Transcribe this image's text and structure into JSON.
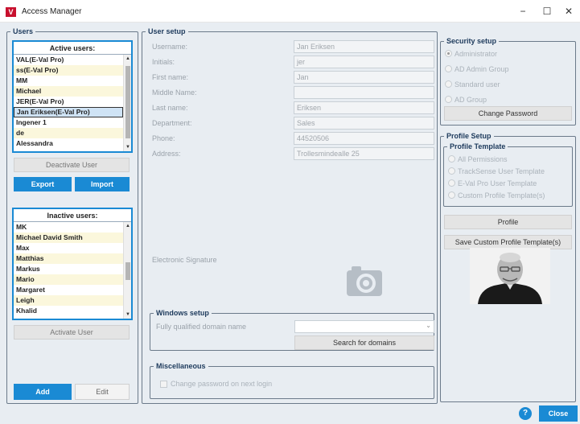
{
  "window": {
    "app_icon_letter": "V",
    "title": "Access Manager",
    "minimize": "−",
    "maximize": "☐",
    "close": "✕"
  },
  "users": {
    "legend": "Users",
    "active_header": "Active users:",
    "active_items": [
      "VAL(E-Val Pro)",
      "ss(E-Val Pro)",
      "MM",
      "Michael",
      "JER(E-Val Pro)",
      "Jan Eriksen(E-Val Pro)",
      "Ingener 1",
      "de",
      "Alessandra"
    ],
    "active_selected_index": 5,
    "deactivate_label": "Deactivate User",
    "export_label": "Export",
    "import_label": "Import",
    "inactive_header": "Inactive users:",
    "inactive_items": [
      "MK",
      "Michael David Smith",
      "Max",
      "Matthias",
      "Markus",
      "Mario",
      "Margaret",
      "Leigh",
      "Khalid"
    ],
    "activate_label": "Activate User",
    "add_label": "Add",
    "edit_label": "Edit"
  },
  "user_setup": {
    "legend": "User setup",
    "fields": [
      {
        "label": "Username:",
        "value": "Jan Eriksen"
      },
      {
        "label": "Initials:",
        "value": "jer"
      },
      {
        "label": "First name:",
        "value": "Jan"
      },
      {
        "label": "Middle Name:",
        "value": ""
      },
      {
        "label": "Last name:",
        "value": "Eriksen"
      },
      {
        "label": "Department:",
        "value": "Sales"
      },
      {
        "label": "Phone:",
        "value": "44520506"
      },
      {
        "label": "Address:",
        "value": "Trollesmindealle 25"
      }
    ],
    "signature_label": "Electronic Signature",
    "camera_icon": "camera-icon",
    "windows_setup": {
      "legend": "Windows setup",
      "domain_label": "Fully qualified domain name",
      "domain_value": "",
      "search_label": "Search for domains"
    },
    "misc": {
      "legend": "Miscellaneous",
      "change_pw_label": "Change password on next login",
      "change_pw_checked": false
    }
  },
  "security": {
    "legend": "Security setup",
    "options": [
      "Administrator",
      "AD Admin Group",
      "Standard user",
      "AD Group"
    ],
    "selected_index": 0,
    "change_password_label": "Change Password"
  },
  "profile": {
    "legend": "Profile Setup",
    "template_legend": "Profile Template",
    "templates": [
      "All Permissions",
      "TrackSense User Template",
      "E-Val Pro User Template",
      "Custom Profile Template(s)"
    ],
    "profile_label": "Profile",
    "save_custom_label": "Save Custom Profile Template(s)"
  },
  "footer": {
    "help_label": "?",
    "close_label": "Close"
  },
  "colors": {
    "accent": "#1a8ad4",
    "brand": "#c8102e",
    "background": "#e8edf2",
    "list_alt_row": "#fbf7dc"
  }
}
